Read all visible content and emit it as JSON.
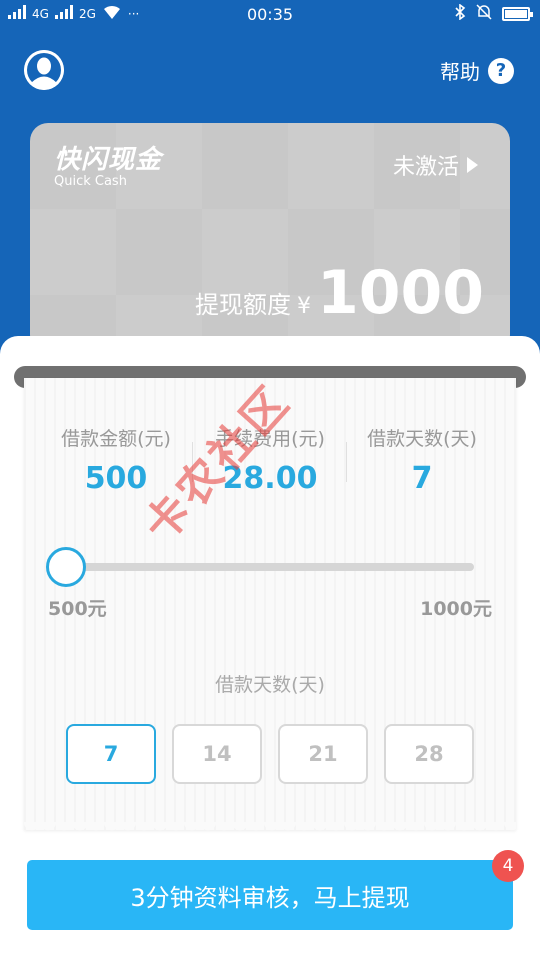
{
  "status_bar": {
    "signal_left": "4G",
    "signal_right": "2G",
    "time": "00:35",
    "more": "···"
  },
  "nav": {
    "help_label": "帮助",
    "help_icon_glyph": "?"
  },
  "card": {
    "logo_cn": "快闪现金",
    "logo_en": "Quick Cash",
    "status": "未激活",
    "limit_label": "提现额度",
    "currency": "¥",
    "limit_amount": "1000"
  },
  "stats": [
    {
      "label": "借款金额(元)",
      "value": "500"
    },
    {
      "label": "手续费用(元)",
      "value": "28.00"
    },
    {
      "label": "借款天数(天)",
      "value": "7"
    }
  ],
  "slider": {
    "min_label": "500元",
    "max_label": "1000元",
    "value_fraction": 0
  },
  "days": {
    "label": "借款天数(天)",
    "options": [
      "7",
      "14",
      "21",
      "28"
    ],
    "selected": "7"
  },
  "cta": {
    "label": "3分钟资料审核，马上提现",
    "badge": "4"
  },
  "watermark": "卡农社区",
  "colors": {
    "header_blue": "#1565b8",
    "accent": "#29a9df",
    "cta": "#29b6f6",
    "badge": "#ef5350",
    "card_grey": "#c8c8c8"
  }
}
